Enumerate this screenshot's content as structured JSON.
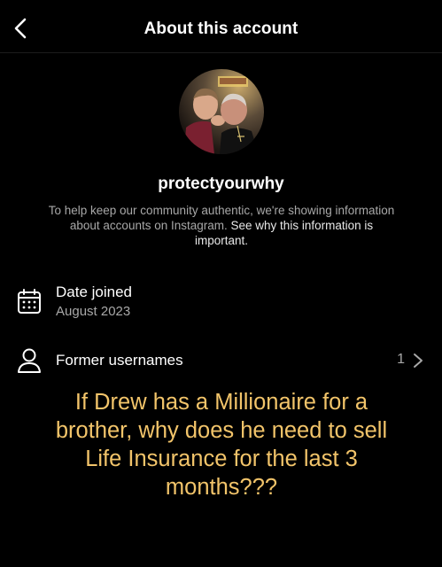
{
  "header": {
    "title": "About this account",
    "back_icon": "chevron-left-icon"
  },
  "profile": {
    "username": "protectyourwhy",
    "description_text": "To help keep our community authentic, we're showing information about accounts on Instagram.",
    "description_link": "See why this information is important."
  },
  "details": {
    "date_joined": {
      "icon": "calendar-icon",
      "label": "Date joined",
      "value": "August 2023"
    },
    "former_usernames": {
      "icon": "person-icon",
      "label": "Former usernames",
      "count": "1",
      "chevron_icon": "chevron-right-icon"
    }
  },
  "overlay_caption": "If Drew has a Millionaire for a brother, why does he need to sell Life Insurance for the last 3 months???",
  "colors": {
    "background": "#000000",
    "text_primary": "#ffffff",
    "text_secondary": "#a8a8a8",
    "caption": "#f2c46a"
  }
}
